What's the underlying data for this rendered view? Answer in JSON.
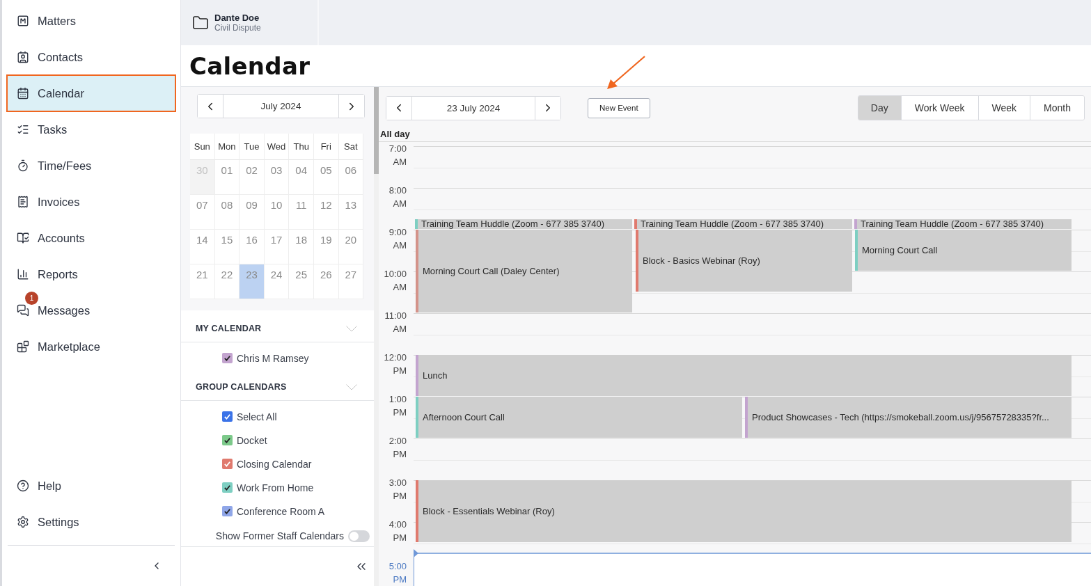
{
  "nav": {
    "items": [
      {
        "kind": "matters",
        "label": "Matters",
        "selected": false
      },
      {
        "kind": "contacts",
        "label": "Contacts",
        "selected": false
      },
      {
        "kind": "calendar",
        "label": "Calendar",
        "selected": true
      },
      {
        "kind": "tasks",
        "label": "Tasks",
        "selected": false
      },
      {
        "kind": "time",
        "label": "Time/Fees",
        "selected": false
      },
      {
        "kind": "invoices",
        "label": "Invoices",
        "selected": false
      },
      {
        "kind": "accounts",
        "label": "Accounts",
        "selected": false
      },
      {
        "kind": "reports",
        "label": "Reports",
        "selected": false
      },
      {
        "kind": "messages",
        "label": "Messages",
        "selected": false,
        "badge": "1"
      },
      {
        "kind": "marketplace",
        "label": "Marketplace",
        "selected": false
      }
    ],
    "footer_items": [
      {
        "kind": "help",
        "label": "Help",
        "selected": false
      },
      {
        "kind": "settings",
        "label": "Settings",
        "selected": false
      }
    ]
  },
  "matter_tab": {
    "name": "Dante Doe",
    "type": "Civil Dispute"
  },
  "page_title": "Calendar",
  "mini_calendar": {
    "month": "July 2024",
    "weekdays": [
      "Sun",
      "Mon",
      "Tue",
      "Wed",
      "Thu",
      "Fri",
      "Sat"
    ],
    "weeks": [
      [
        {
          "day": "30",
          "outside": true,
          "selected": false
        },
        {
          "day": "01",
          "outside": false,
          "selected": false
        },
        {
          "day": "02",
          "outside": false,
          "selected": false
        },
        {
          "day": "03",
          "outside": false,
          "selected": false
        },
        {
          "day": "04",
          "outside": false,
          "selected": false
        },
        {
          "day": "05",
          "outside": false,
          "selected": false
        },
        {
          "day": "06",
          "outside": false,
          "selected": false
        }
      ],
      [
        {
          "day": "07",
          "outside": false,
          "selected": false
        },
        {
          "day": "08",
          "outside": false,
          "selected": false
        },
        {
          "day": "09",
          "outside": false,
          "selected": false
        },
        {
          "day": "10",
          "outside": false,
          "selected": false
        },
        {
          "day": "11",
          "outside": false,
          "selected": false
        },
        {
          "day": "12",
          "outside": false,
          "selected": false
        },
        {
          "day": "13",
          "outside": false,
          "selected": false
        }
      ],
      [
        {
          "day": "14",
          "outside": false,
          "selected": false
        },
        {
          "day": "15",
          "outside": false,
          "selected": false
        },
        {
          "day": "16",
          "outside": false,
          "selected": false
        },
        {
          "day": "17",
          "outside": false,
          "selected": false
        },
        {
          "day": "18",
          "outside": false,
          "selected": false
        },
        {
          "day": "19",
          "outside": false,
          "selected": false
        },
        {
          "day": "20",
          "outside": false,
          "selected": false
        }
      ],
      [
        {
          "day": "21",
          "outside": false,
          "selected": false
        },
        {
          "day": "22",
          "outside": false,
          "selected": false
        },
        {
          "day": "23",
          "outside": false,
          "selected": true
        },
        {
          "day": "24",
          "outside": false,
          "selected": false
        },
        {
          "day": "25",
          "outside": false,
          "selected": false
        },
        {
          "day": "26",
          "outside": false,
          "selected": false
        },
        {
          "day": "27",
          "outside": false,
          "selected": false
        }
      ]
    ]
  },
  "my_calendar": {
    "title": "MY CALENDAR",
    "items": [
      {
        "label": "Chris M Ramsey",
        "checked": true,
        "color": "#c3a4cf"
      }
    ]
  },
  "group_calendars": {
    "title": "GROUP CALENDARS",
    "items": [
      {
        "label": "Select All",
        "checked": true,
        "color": "#3b73e8"
      },
      {
        "label": "Docket",
        "checked": true,
        "color": "#7cc98a"
      },
      {
        "label": "Closing Calendar",
        "checked": true,
        "color": "#e07a6e"
      },
      {
        "label": "Work From Home",
        "checked": true,
        "color": "#7ecfc2"
      },
      {
        "label": "Conference Room A",
        "checked": true,
        "color": "#8fa6e8"
      }
    ]
  },
  "former_staff": {
    "label": "Show Former Staff Calendars",
    "on": false
  },
  "toolbar": {
    "date": "23 July 2024",
    "new_event": "New Event",
    "views": [
      {
        "label": "Day",
        "selected": true
      },
      {
        "label": "Work Week",
        "selected": false
      },
      {
        "label": "Week",
        "selected": false
      },
      {
        "label": "Month",
        "selected": false
      }
    ]
  },
  "day_view": {
    "all_day_label": "All day",
    "hours": [
      {
        "hour": "7:00",
        "period": "AM",
        "current": false
      },
      {
        "hour": "8:00",
        "period": "AM",
        "current": false
      },
      {
        "hour": "9:00",
        "period": "AM",
        "current": false
      },
      {
        "hour": "10:00",
        "period": "AM",
        "current": false
      },
      {
        "hour": "11:00",
        "period": "AM",
        "current": false
      },
      {
        "hour": "12:00",
        "period": "PM",
        "current": false
      },
      {
        "hour": "1:00",
        "period": "PM",
        "current": false
      },
      {
        "hour": "2:00",
        "period": "PM",
        "current": false
      },
      {
        "hour": "3:00",
        "period": "PM",
        "current": false
      },
      {
        "hour": "4:00",
        "period": "PM",
        "current": false
      },
      {
        "hour": "5:00",
        "period": "PM",
        "current": true
      }
    ],
    "events": [
      {
        "title": "Training Team Huddle (Zoom - 677 385 3740)",
        "color": "#7ecfc2"
      },
      {
        "title": "Training Team Huddle (Zoom - 677 385 3740)",
        "color": "#e07a6e"
      },
      {
        "title": "Training Team Huddle (Zoom - 677 385 3740)",
        "color": "#c3a4cf"
      },
      {
        "title": "Morning Court Call (Daley Center)",
        "color": "#d4938a"
      },
      {
        "title": "Block - Basics Webinar (Roy)",
        "color": "#e07a6e"
      },
      {
        "title": "Morning Court Call",
        "color": "#7ecfc2"
      },
      {
        "title": "Lunch",
        "color": "#c3a4cf"
      },
      {
        "title": "Afternoon Court Call",
        "color": "#7ecfc2"
      },
      {
        "title": "Product Showcases - Tech (https://smokeball.zoom.us/j/95675728335?fr...",
        "color": "#c3a4cf"
      },
      {
        "title": "Block - Essentials Webinar (Roy)",
        "color": "#e07a6e"
      }
    ]
  }
}
